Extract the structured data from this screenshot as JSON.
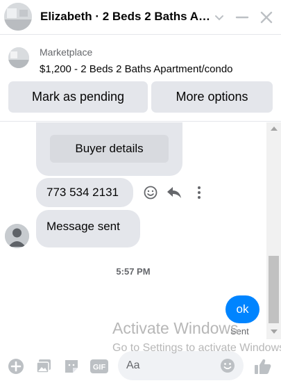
{
  "header": {
    "title": "Elizabeth · 2 Beds 2 Baths Apartment/condo"
  },
  "listing": {
    "marketplace_label": "Marketplace",
    "title": "$1,200 - 2 Beds 2 Baths Apartment/condo",
    "mark_pending_label": "Mark as pending",
    "more_options_label": "More options"
  },
  "chat": {
    "buyer_details_label": "Buyer details",
    "phone_message": "773 534 2131",
    "message_sent": "Message sent",
    "timestamp": "5:57 PM",
    "outgoing_message": "ok",
    "sent_status": "Sent"
  },
  "watermark": {
    "line1": "Activate Windows",
    "line2": "Go to Settings to activate Windows."
  },
  "composer": {
    "placeholder": "Aa"
  },
  "colors": {
    "accent": "#0084ff",
    "bubble_gray": "#e4e6eb",
    "icon_gray": "#bcc0c4"
  }
}
